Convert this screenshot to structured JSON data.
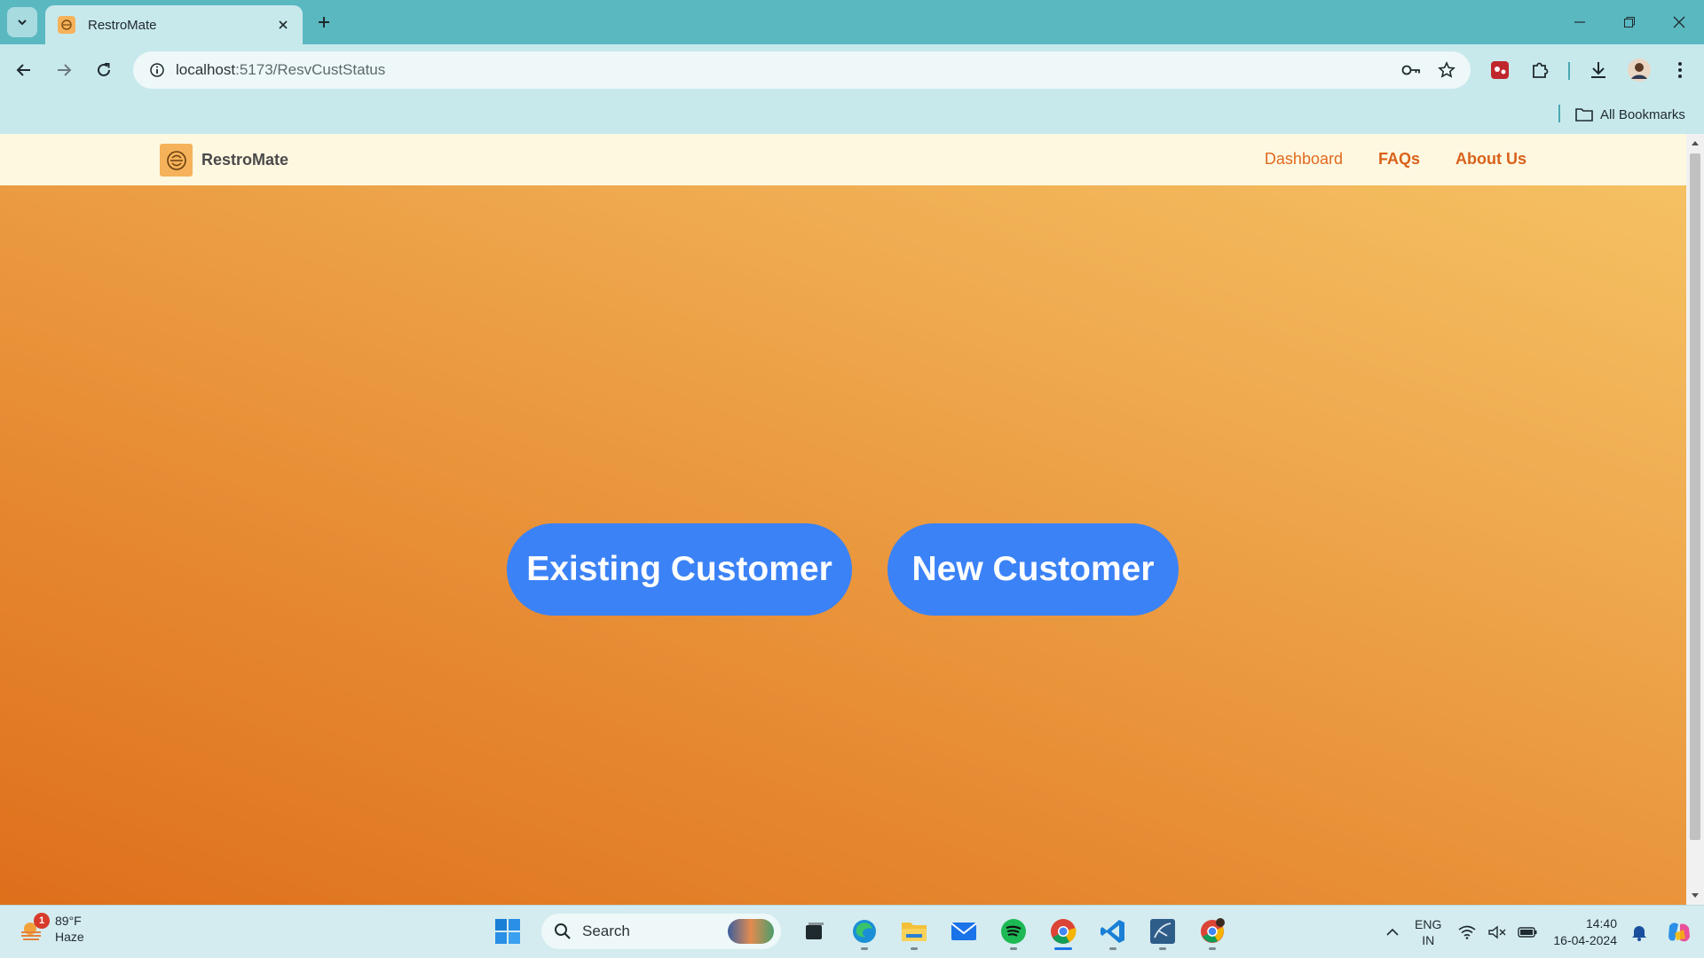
{
  "browser": {
    "tab": {
      "title": "RestroMate"
    },
    "address": {
      "host": "localhost",
      "path": ":5173/ResvCustStatus"
    },
    "bookmarks_label": "All Bookmarks"
  },
  "app": {
    "brand": "RestroMate",
    "nav": {
      "dashboard": "Dashboard",
      "faqs": "FAQs",
      "about": "About Us"
    },
    "buttons": {
      "existing": "Existing Customer",
      "new": "New Customer"
    },
    "colors": {
      "primary_button": "#3b82f6",
      "nav_bg": "#fef8e1",
      "link": "#e06a1e",
      "gradient_start": "#de6f1c",
      "gradient_end": "#f5c162"
    }
  },
  "taskbar": {
    "weather": {
      "temp": "89°F",
      "condition": "Haze",
      "badge": "1"
    },
    "search_label": "Search",
    "language": {
      "line1": "ENG",
      "line2": "IN"
    },
    "clock": {
      "time": "14:40",
      "date": "16-04-2024"
    },
    "apps": [
      "windows-start-icon",
      "task-view-icon",
      "edge-icon",
      "file-explorer-icon",
      "mail-icon",
      "spotify-icon",
      "chrome-icon",
      "vscode-icon",
      "mysql-workbench-icon",
      "chrome-profile-icon"
    ]
  }
}
